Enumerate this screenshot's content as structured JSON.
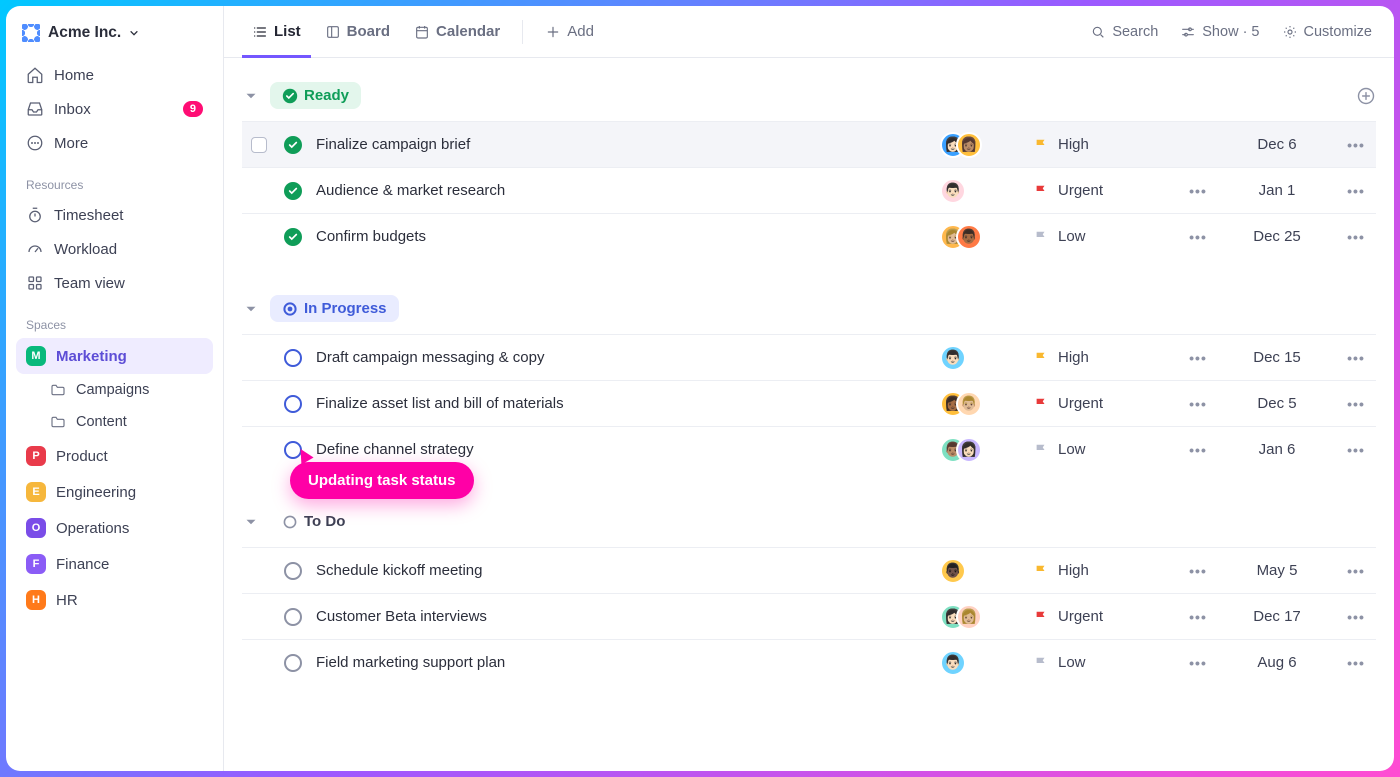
{
  "workspace": {
    "name": "Acme Inc."
  },
  "sidebar": {
    "nav": [
      {
        "label": "Home"
      },
      {
        "label": "Inbox",
        "badge": "9"
      },
      {
        "label": "More"
      }
    ],
    "resources_label": "Resources",
    "resources": [
      {
        "label": "Timesheet"
      },
      {
        "label": "Workload"
      },
      {
        "label": "Team view"
      }
    ],
    "spaces_label": "Spaces",
    "spaces": [
      {
        "letter": "M",
        "label": "Marketing",
        "color": "#08b97c",
        "active": true,
        "children": [
          {
            "label": "Campaigns"
          },
          {
            "label": "Content"
          }
        ]
      },
      {
        "letter": "P",
        "label": "Product",
        "color": "#e93b4b"
      },
      {
        "letter": "E",
        "label": "Engineering",
        "color": "#f6b73c"
      },
      {
        "letter": "O",
        "label": "Operations",
        "color": "#7a4de8"
      },
      {
        "letter": "F",
        "label": "Finance",
        "color": "#8b5cf6"
      },
      {
        "letter": "H",
        "label": "HR",
        "color": "#ff7a1a"
      }
    ]
  },
  "topbar": {
    "views": [
      {
        "label": "List",
        "active": true
      },
      {
        "label": "Board"
      },
      {
        "label": "Calendar"
      }
    ],
    "add_label": "Add",
    "search_label": "Search",
    "show_label": "Show · 5",
    "customize_label": "Customize"
  },
  "tooltip": {
    "text": "Updating task status"
  },
  "groups": [
    {
      "id": "ready",
      "label": "Ready",
      "style": "ready",
      "tasks": [
        {
          "title": "Finalize campaign brief",
          "priority": "High",
          "priority_key": "high",
          "due": "Dec 6",
          "hovered": true,
          "show_checkbox": true,
          "show_extras": false,
          "assignees": [
            {
              "bg": "#3aa0ff",
              "em": "👩🏻"
            },
            {
              "bg": "#ffbf3c",
              "em": "👩🏽"
            }
          ]
        },
        {
          "title": "Audience & market research",
          "priority": "Urgent",
          "priority_key": "urgent",
          "due": "Jan 1",
          "show_extras": true,
          "assignees": [
            {
              "bg": "#ffd7e0",
              "em": "👨🏻"
            }
          ]
        },
        {
          "title": "Confirm budgets",
          "priority": "Low",
          "priority_key": "low",
          "due": "Dec 25",
          "show_extras": true,
          "assignees": [
            {
              "bg": "#ffb84d",
              "em": "👩🏼"
            },
            {
              "bg": "#ff7a45",
              "em": "👨🏾"
            }
          ]
        }
      ]
    },
    {
      "id": "inprogress",
      "label": "In Progress",
      "style": "inprogress",
      "tasks": [
        {
          "title": "Draft campaign messaging & copy",
          "priority": "High",
          "priority_key": "high",
          "due": "Dec 15",
          "show_extras": true,
          "assignees": [
            {
              "bg": "#6fd3ff",
              "em": "👨🏻"
            }
          ]
        },
        {
          "title": "Finalize asset list and bill of materials",
          "priority": "Urgent",
          "priority_key": "urgent",
          "due": "Dec 5",
          "show_extras": true,
          "assignees": [
            {
              "bg": "#ffbf3c",
              "em": "👩🏾"
            },
            {
              "bg": "#ffd7b0",
              "em": "👨🏼"
            }
          ]
        },
        {
          "title": "Define channel strategy",
          "priority": "Low",
          "priority_key": "low",
          "due": "Jan 6",
          "show_extras": true,
          "assignees": [
            {
              "bg": "#7ee0c2",
              "em": "👨🏽"
            },
            {
              "bg": "#c7b6ff",
              "em": "👩🏻"
            }
          ]
        }
      ]
    },
    {
      "id": "todo",
      "label": "To Do",
      "style": "todo",
      "tasks": [
        {
          "title": "Schedule kickoff meeting",
          "priority": "High",
          "priority_key": "high",
          "due": "May 5",
          "show_extras": true,
          "assignees": [
            {
              "bg": "#ffc94d",
              "em": "👨🏿"
            }
          ]
        },
        {
          "title": "Customer Beta interviews",
          "priority": "Urgent",
          "priority_key": "urgent",
          "due": "Dec 17",
          "show_extras": true,
          "assignees": [
            {
              "bg": "#7ee0c2",
              "em": "👩🏻"
            },
            {
              "bg": "#ffd1c2",
              "em": "👩🏼"
            }
          ]
        },
        {
          "title": "Field marketing support plan",
          "priority": "Low",
          "priority_key": "low",
          "due": "Aug 6",
          "show_extras": true,
          "assignees": [
            {
              "bg": "#6fd3ff",
              "em": "👨🏻"
            }
          ]
        }
      ]
    }
  ]
}
